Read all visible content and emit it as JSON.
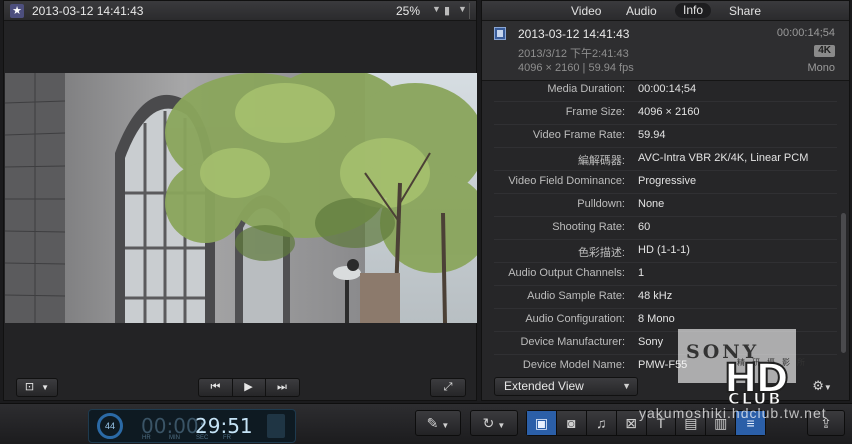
{
  "viewer": {
    "title": "2013-03-12 14:41:43",
    "zoom": "25%",
    "favorite_icon": "star-icon"
  },
  "inspector": {
    "tabs": [
      {
        "label": "Video",
        "active": false
      },
      {
        "label": "Audio",
        "active": false
      },
      {
        "label": "Info",
        "active": true
      },
      {
        "label": "Share",
        "active": false
      }
    ],
    "summary": {
      "name": "2013-03-12 14:41:43",
      "duration": "00:00:14;54",
      "date": "2013/3/12 下午2:41:43",
      "badge": "4K",
      "format": "4096 × 2160 | 59.94 fps",
      "audio": "Mono"
    },
    "rows": [
      {
        "label": "Media Duration:",
        "value": "00:00:14;54"
      },
      {
        "label": "Frame Size:",
        "value": "4096 × 2160"
      },
      {
        "label": "Video Frame Rate:",
        "value": "59.94"
      },
      {
        "label": "編解碼器:",
        "value": "AVC-Intra VBR 2K/4K, Linear PCM"
      },
      {
        "label": "Video Field Dominance:",
        "value": "Progressive"
      },
      {
        "label": "Pulldown:",
        "value": "None"
      },
      {
        "label": "Shooting Rate:",
        "value": "60"
      },
      {
        "label": "色彩描述:",
        "value": "HD (1-1-1)"
      },
      {
        "label": "Audio Output Channels:",
        "value": "1"
      },
      {
        "label": "Audio Sample Rate:",
        "value": "48 kHz"
      },
      {
        "label": "Audio Configuration:",
        "value": "8 Mono"
      },
      {
        "label": "Device Manufacturer:",
        "value": "Sony"
      },
      {
        "label": "Device Model Name:",
        "value": "PMW-F55"
      }
    ],
    "view_selector": "Extended View"
  },
  "toolbar": {
    "progress": "44",
    "timecode_dim": "00:00:",
    "timecode_bright": "29:51",
    "timecode_units": [
      "HR",
      "MIN",
      "SEC",
      "FR"
    ]
  },
  "watermark": {
    "brand": "SONY",
    "chinese": "精研攝影所",
    "hd": "HD",
    "club": "CLUB",
    "url": "yakumoshiki.hdclub.tw.net"
  },
  "colors": {
    "accent": "#2b5fa8",
    "panel": "#262628",
    "dashboard_text": "#c5e3f6"
  }
}
